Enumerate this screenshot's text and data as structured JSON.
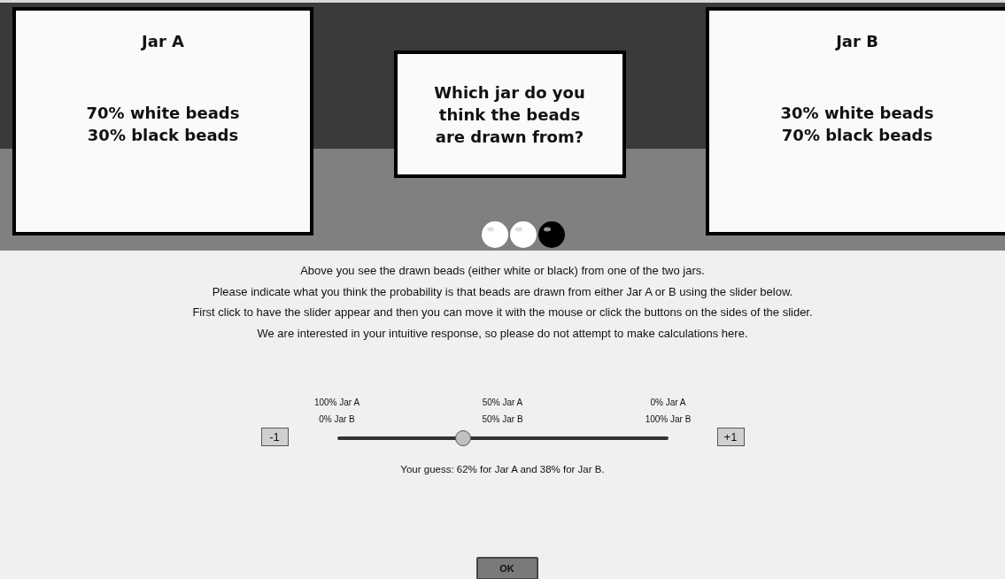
{
  "jars": [
    {
      "title": "Jar A",
      "lines": [
        "70% white beads",
        "30% black beads"
      ]
    },
    {
      "title": "Jar B",
      "lines": [
        "30% white beads",
        "70% black beads"
      ]
    }
  ],
  "question": [
    "Which jar do you",
    "think the beads",
    "are drawn from?"
  ],
  "beads": [
    {
      "color": "#ffffff"
    },
    {
      "color": "#ffffff"
    },
    {
      "color": "#000000"
    }
  ],
  "instructions": [
    "Above you see the drawn beads (either white or black) from one of the two jars.",
    "Please indicate what you think the probability is that beads are drawn from either Jar A or B using the slider below.",
    "First click to have the slider appear and then you can move it with the mouse or click the buttons on the sides of the slider.",
    "We are interested in your intuitive response, so please do not attempt to make calculations here."
  ],
  "slider": {
    "minus_button": "-1",
    "plus_button": "+1",
    "level": 0.38,
    "labels": [
      [
        "100% Jar A",
        "0% Jar B"
      ],
      [
        "50% Jar A",
        "50% Jar B"
      ],
      [
        "0% Jar A",
        "100% Jar B"
      ]
    ]
  },
  "guess": "Your guess: 62% for Jar A and 38% for Jar B.",
  "ok_button": "OK"
}
